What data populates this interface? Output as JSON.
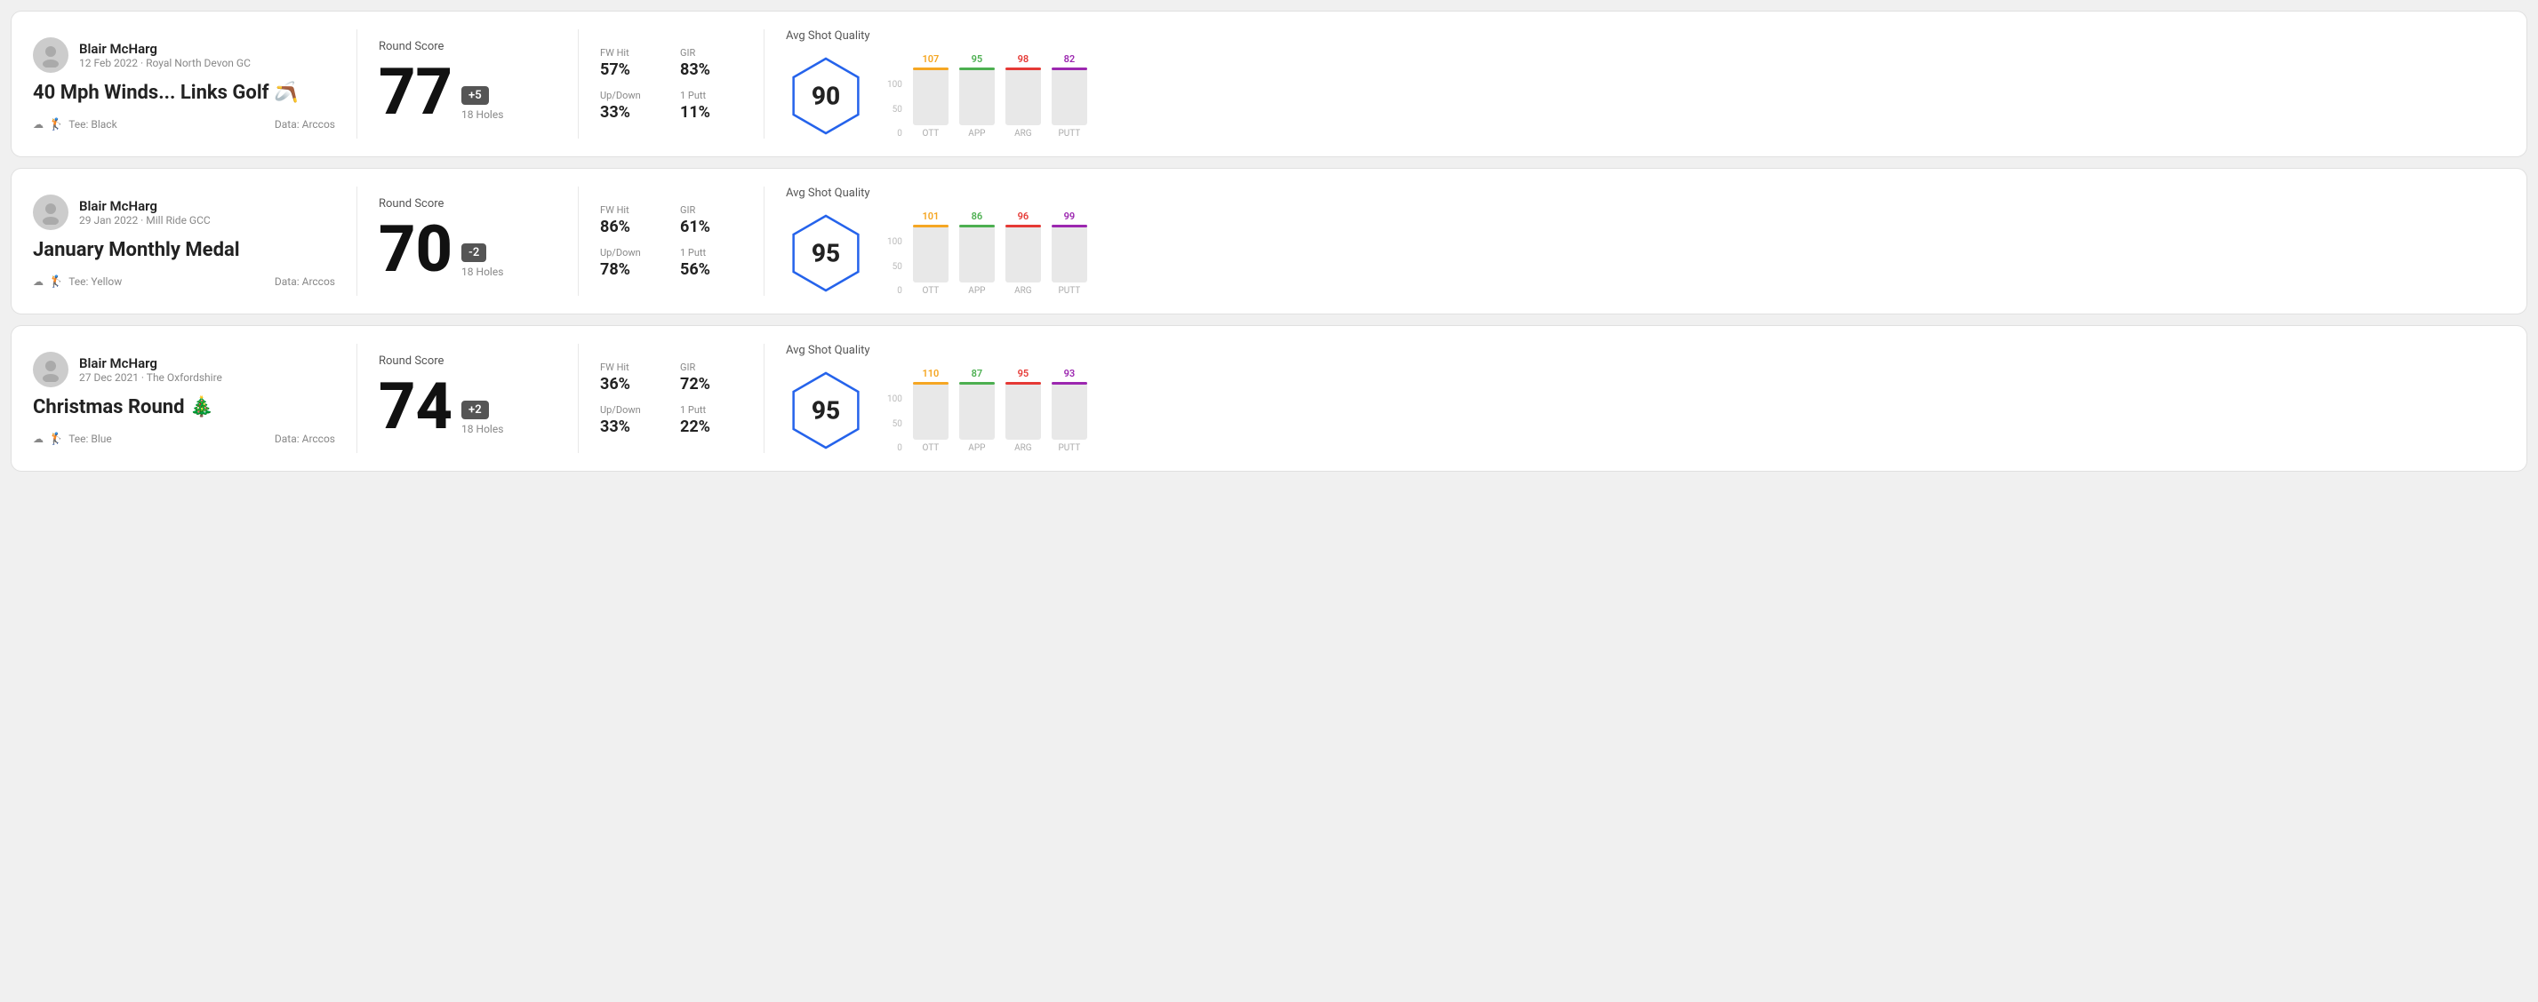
{
  "rounds": [
    {
      "id": "round1",
      "user": {
        "name": "Blair McHarg",
        "date_course": "12 Feb 2022 · Royal North Devon GC"
      },
      "title": "40 Mph Winds... Links Golf 🪃",
      "tee": "Black",
      "data_source": "Data: Arccos",
      "score": {
        "label": "Round Score",
        "number": "77",
        "modifier": "+5",
        "modifier_type": "plus",
        "holes": "18 Holes"
      },
      "stats": {
        "fw_hit_label": "FW Hit",
        "fw_hit_value": "57%",
        "gir_label": "GIR",
        "gir_value": "83%",
        "updown_label": "Up/Down",
        "updown_value": "33%",
        "oneputt_label": "1 Putt",
        "oneputt_value": "11%"
      },
      "quality": {
        "label": "Avg Shot Quality",
        "score": "90",
        "bars": [
          {
            "category": "OTT",
            "value": 107,
            "color_class": "ott-bar",
            "text_class": "ott-color",
            "pct": 100
          },
          {
            "category": "APP",
            "value": 95,
            "color_class": "app-bar",
            "text_class": "app-color",
            "pct": 89
          },
          {
            "category": "ARG",
            "value": 98,
            "color_class": "arg-bar",
            "text_class": "arg-color",
            "pct": 92
          },
          {
            "category": "PUTT",
            "value": 82,
            "color_class": "putt-bar",
            "text_class": "putt-color",
            "pct": 77
          }
        ]
      }
    },
    {
      "id": "round2",
      "user": {
        "name": "Blair McHarg",
        "date_course": "29 Jan 2022 · Mill Ride GCC"
      },
      "title": "January Monthly Medal",
      "tee": "Yellow",
      "data_source": "Data: Arccos",
      "score": {
        "label": "Round Score",
        "number": "70",
        "modifier": "-2",
        "modifier_type": "minus",
        "holes": "18 Holes"
      },
      "stats": {
        "fw_hit_label": "FW Hit",
        "fw_hit_value": "86%",
        "gir_label": "GIR",
        "gir_value": "61%",
        "updown_label": "Up/Down",
        "updown_value": "78%",
        "oneputt_label": "1 Putt",
        "oneputt_value": "56%"
      },
      "quality": {
        "label": "Avg Shot Quality",
        "score": "95",
        "bars": [
          {
            "category": "OTT",
            "value": 101,
            "color_class": "ott-bar",
            "text_class": "ott-color",
            "pct": 100
          },
          {
            "category": "APP",
            "value": 86,
            "color_class": "app-bar",
            "text_class": "app-color",
            "pct": 85
          },
          {
            "category": "ARG",
            "value": 96,
            "color_class": "arg-bar",
            "text_class": "arg-color",
            "pct": 95
          },
          {
            "category": "PUTT",
            "value": 99,
            "color_class": "putt-bar",
            "text_class": "putt-color",
            "pct": 98
          }
        ]
      }
    },
    {
      "id": "round3",
      "user": {
        "name": "Blair McHarg",
        "date_course": "27 Dec 2021 · The Oxfordshire"
      },
      "title": "Christmas Round 🎄",
      "tee": "Blue",
      "data_source": "Data: Arccos",
      "score": {
        "label": "Round Score",
        "number": "74",
        "modifier": "+2",
        "modifier_type": "plus",
        "holes": "18 Holes"
      },
      "stats": {
        "fw_hit_label": "FW Hit",
        "fw_hit_value": "36%",
        "gir_label": "GIR",
        "gir_value": "72%",
        "updown_label": "Up/Down",
        "updown_value": "33%",
        "oneputt_label": "1 Putt",
        "oneputt_value": "22%"
      },
      "quality": {
        "label": "Avg Shot Quality",
        "score": "95",
        "bars": [
          {
            "category": "OTT",
            "value": 110,
            "color_class": "ott-bar",
            "text_class": "ott-color",
            "pct": 100
          },
          {
            "category": "APP",
            "value": 87,
            "color_class": "app-bar",
            "text_class": "app-color",
            "pct": 79
          },
          {
            "category": "ARG",
            "value": 95,
            "color_class": "arg-bar",
            "text_class": "arg-color",
            "pct": 86
          },
          {
            "category": "PUTT",
            "value": 93,
            "color_class": "putt-bar",
            "text_class": "putt-color",
            "pct": 85
          }
        ]
      }
    }
  ],
  "y_axis_labels": [
    "100",
    "50",
    "0"
  ],
  "tee_icon": "☁",
  "bag_icon": "🏌"
}
